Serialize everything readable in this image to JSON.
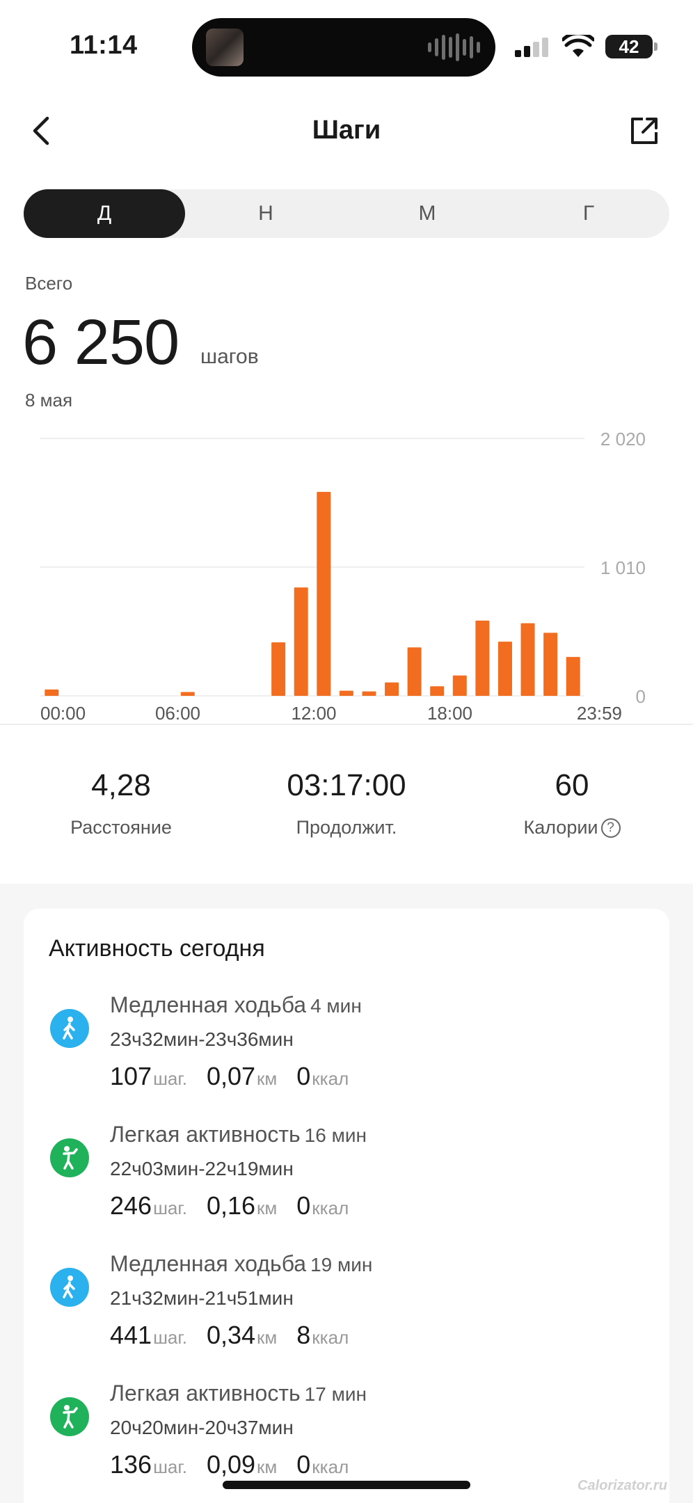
{
  "status_bar": {
    "time": "11:14",
    "battery": "42"
  },
  "header": {
    "title": "Шаги"
  },
  "tabs": [
    {
      "label": "Д",
      "active": true
    },
    {
      "label": "Н",
      "active": false
    },
    {
      "label": "М",
      "active": false
    },
    {
      "label": "Г",
      "active": false
    }
  ],
  "summary": {
    "total_label": "Всего",
    "total_value": "6 250",
    "total_unit": "шагов",
    "date": "8 мая"
  },
  "chart_data": {
    "type": "bar",
    "color": "#f26d1f",
    "y_ticks": [
      "2 020",
      "1 010",
      "0"
    ],
    "ylim": [
      0,
      2020
    ],
    "x_ticks": [
      "00:00",
      "06:00",
      "12:00",
      "18:00",
      "23:59"
    ],
    "x_tick_hours": [
      0,
      6,
      12,
      18,
      24
    ],
    "hours": [
      0,
      6,
      10,
      11,
      12,
      13,
      14,
      15,
      16,
      17,
      18,
      19,
      20,
      21,
      22,
      23
    ],
    "values": [
      50,
      30,
      420,
      850,
      1600,
      40,
      35,
      105,
      380,
      75,
      160,
      590,
      425,
      570,
      495,
      305
    ]
  },
  "stats": [
    {
      "value": "4,28",
      "label": "Расстояние",
      "help": false
    },
    {
      "value": "03:17:00",
      "label": "Продолжит.",
      "help": false
    },
    {
      "value": "60",
      "label": "Калории",
      "help": true
    }
  ],
  "activity": {
    "title": "Активность сегодня",
    "items": [
      {
        "type": "slow-walk",
        "icon": "walking-person-icon",
        "color": "#2bb2ee",
        "name": "Медленная ходьба",
        "duration": "4 мин",
        "range": "23ч32мин-23ч36мин",
        "steps": "107",
        "steps_unit": "шаг.",
        "distance": "0,07",
        "distance_unit": "км",
        "kcal": "0",
        "kcal_unit": "ккал"
      },
      {
        "type": "light-activity",
        "icon": "running-person-icon",
        "color": "#1fb25a",
        "name": "Легкая активность",
        "duration": "16 мин",
        "range": "22ч03мин-22ч19мин",
        "steps": "246",
        "steps_unit": "шаг.",
        "distance": "0,16",
        "distance_unit": "км",
        "kcal": "0",
        "kcal_unit": "ккал"
      },
      {
        "type": "slow-walk",
        "icon": "walking-person-icon",
        "color": "#2bb2ee",
        "name": "Медленная ходьба",
        "duration": "19 мин",
        "range": "21ч32мин-21ч51мин",
        "steps": "441",
        "steps_unit": "шаг.",
        "distance": "0,34",
        "distance_unit": "км",
        "kcal": "8",
        "kcal_unit": "ккал"
      },
      {
        "type": "light-activity",
        "icon": "running-person-icon",
        "color": "#1fb25a",
        "name": "Легкая активность",
        "duration": "17 мин",
        "range": "20ч20мин-20ч37мин",
        "steps": "136",
        "steps_unit": "шаг.",
        "distance": "0,09",
        "distance_unit": "км",
        "kcal": "0",
        "kcal_unit": "ккал"
      }
    ]
  },
  "watermark": "Calorizator.ru"
}
